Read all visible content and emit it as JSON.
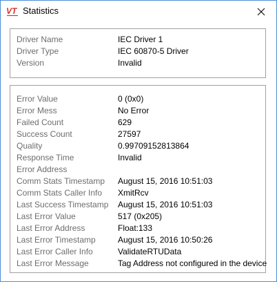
{
  "window": {
    "title": "Statistics",
    "icon": "vt-logo-icon",
    "icon_text": "VT",
    "close_icon": "close-icon",
    "accent_color": "#4a8fd6",
    "logo_color": "#d9332b"
  },
  "driver_info": [
    {
      "label": "Driver Name",
      "value": "IEC Driver 1"
    },
    {
      "label": "Driver Type",
      "value": "IEC 60870-5 Driver"
    },
    {
      "label": "Version",
      "value": "Invalid"
    }
  ],
  "statistics": [
    {
      "label": "Error Value",
      "value": "0 (0x0)"
    },
    {
      "label": "Error Mess",
      "value": "No Error"
    },
    {
      "label": "Failed Count",
      "value": "629"
    },
    {
      "label": "Success Count",
      "value": "27597"
    },
    {
      "label": "Quality",
      "value": "0.99709152813864"
    },
    {
      "label": "Response Time",
      "value": "Invalid"
    },
    {
      "label": "Error Address",
      "value": ""
    },
    {
      "label": "Comm Stats Timestamp",
      "value": "August 15, 2016 10:51:03"
    },
    {
      "label": "Comm Stats Caller Info",
      "value": "XmitRcv"
    },
    {
      "label": "Last Success Timestamp",
      "value": "August 15, 2016 10:51:03"
    },
    {
      "label": "Last Error Value",
      "value": "517 (0x205)"
    },
    {
      "label": "Last Error Address",
      "value": "Float:133"
    },
    {
      "label": "Last Error Timestamp",
      "value": "August 15, 2016 10:50:26"
    },
    {
      "label": "Last Error Caller Info",
      "value": "ValidateRTUData"
    },
    {
      "label": "Last Error Message",
      "value": "Tag Address not configured in the device"
    }
  ]
}
